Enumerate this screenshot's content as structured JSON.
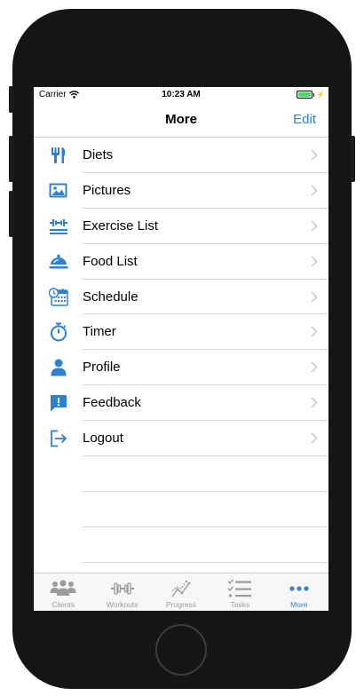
{
  "status_bar": {
    "carrier": "Carrier",
    "time": "10:23 AM"
  },
  "nav": {
    "title": "More",
    "edit_label": "Edit"
  },
  "menu": [
    {
      "label": "Diets",
      "icon": "fork-knife-icon"
    },
    {
      "label": "Pictures",
      "icon": "image-icon"
    },
    {
      "label": "Exercise List",
      "icon": "dumbbell-list-icon"
    },
    {
      "label": "Food List",
      "icon": "cloche-icon"
    },
    {
      "label": "Schedule",
      "icon": "calendar-clock-icon"
    },
    {
      "label": "Timer",
      "icon": "stopwatch-icon"
    },
    {
      "label": "Profile",
      "icon": "person-icon"
    },
    {
      "label": "Feedback",
      "icon": "feedback-icon"
    },
    {
      "label": "Logout",
      "icon": "logout-icon"
    }
  ],
  "tabs": [
    {
      "label": "Clients",
      "icon": "people-icon",
      "active": false
    },
    {
      "label": "Workouts",
      "icon": "dumbbell-icon",
      "active": false
    },
    {
      "label": "Progress",
      "icon": "chart-icon",
      "active": false
    },
    {
      "label": "Tasks",
      "icon": "checklist-icon",
      "active": false
    },
    {
      "label": "More",
      "icon": "ellipsis-icon",
      "active": true
    }
  ],
  "colors": {
    "accent": "#2f80d3",
    "tab_inactive": "#9b9b9b",
    "battery": "#4cd964"
  }
}
